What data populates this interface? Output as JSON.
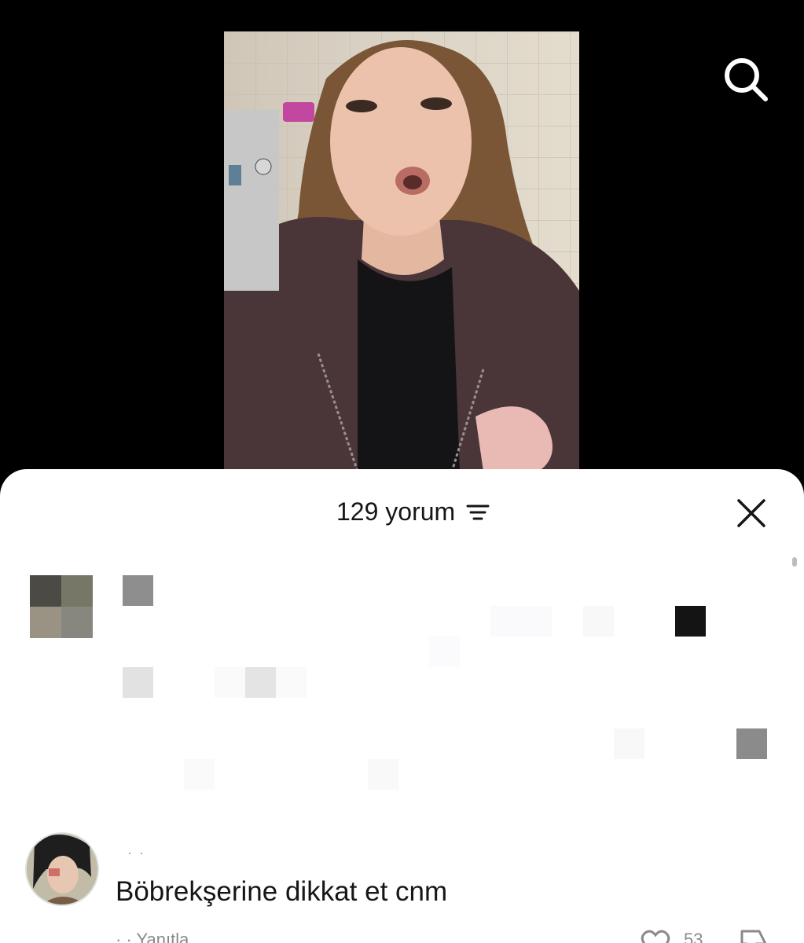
{
  "video": {
    "search_icon": "search-icon"
  },
  "comments_sheet": {
    "header_title": "129 yorum",
    "sort_icon": "sort-lines-icon",
    "close_icon": "close-x-icon"
  },
  "comment": {
    "username": "· ·",
    "text": "Böbrekşerine dikkat et cnm",
    "meta": "· · Yanıtla",
    "like_count": "53",
    "like_icon": "heart-icon",
    "dislike_icon": "thumbs-down-icon"
  },
  "colors": {
    "background": "#000000",
    "sheet": "#ffffff",
    "text_primary": "#161616",
    "text_secondary": "#8a8a8a"
  }
}
